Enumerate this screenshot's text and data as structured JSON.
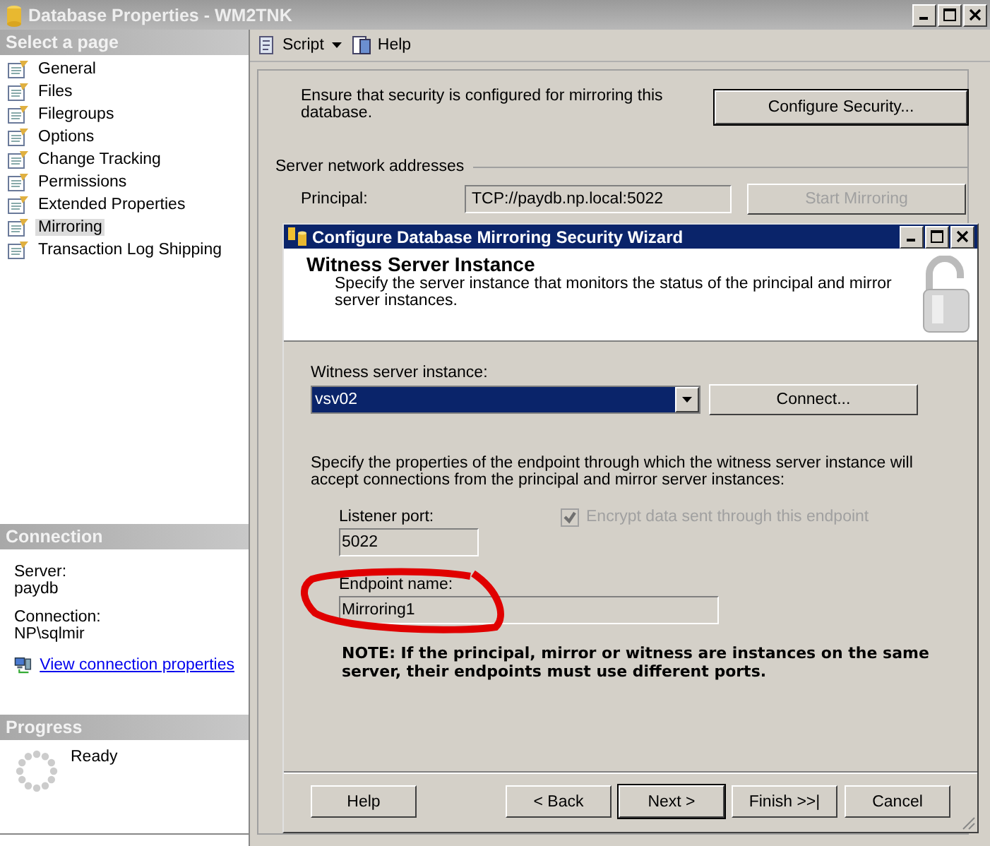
{
  "window": {
    "title": "Database Properties - WM2TNK"
  },
  "sidebar": {
    "header": "Select a page",
    "items": [
      {
        "label": "General",
        "selected": false
      },
      {
        "label": "Files",
        "selected": false
      },
      {
        "label": "Filegroups",
        "selected": false
      },
      {
        "label": "Options",
        "selected": false
      },
      {
        "label": "Change Tracking",
        "selected": false
      },
      {
        "label": "Permissions",
        "selected": false
      },
      {
        "label": "Extended Properties",
        "selected": false
      },
      {
        "label": "Mirroring",
        "selected": true
      },
      {
        "label": "Transaction Log Shipping",
        "selected": false
      }
    ]
  },
  "connection": {
    "header": "Connection",
    "server_label": "Server:",
    "server": "paydb",
    "connection_label": "Connection:",
    "connection": "NP\\sqlmir",
    "link": "View connection properties"
  },
  "progress": {
    "header": "Progress",
    "status": "Ready"
  },
  "toolbar": {
    "script": "Script",
    "help": "Help"
  },
  "mirroring": {
    "security_text": "Ensure that security is configured for mirroring this database.",
    "configure_button": "Configure Security...",
    "section": "Server network addresses",
    "principal_label": "Principal:",
    "principal_value": "TCP://paydb.np.local:5022",
    "start_button": "Start Mirroring",
    "start_disabled": true
  },
  "wizard": {
    "title": "Configure Database Mirroring Security Wizard",
    "heading": "Witness Server Instance",
    "description": "Specify the server instance that monitors the status of the principal and mirror server instances.",
    "witness_label": "Witness server instance:",
    "witness_value": "vsv02",
    "connect_button": "Connect...",
    "endpoint_text": "Specify the properties of the endpoint through which the witness server instance will accept connections from the principal and mirror server instances:",
    "port_label": "Listener port:",
    "port_value": "5022",
    "encrypt": {
      "label": "Encrypt data sent through this endpoint",
      "checked": true,
      "disabled": true
    },
    "endpoint_label": "Endpoint name:",
    "endpoint_value": "Mirroring1",
    "endpoint_circled": true,
    "note": "NOTE: If the principal, mirror or witness are instances on the same server, their endpoints must use different ports.",
    "buttons": [
      {
        "label": "Help",
        "kind": "help",
        "default": false
      },
      {
        "label": "< Back",
        "kind": "nav",
        "default": false
      },
      {
        "label": "Next >",
        "kind": "nav",
        "default": true
      },
      {
        "label": "Finish >>|",
        "kind": "nav",
        "default": false
      },
      {
        "label": "Cancel",
        "kind": "nav",
        "default": false
      }
    ]
  }
}
